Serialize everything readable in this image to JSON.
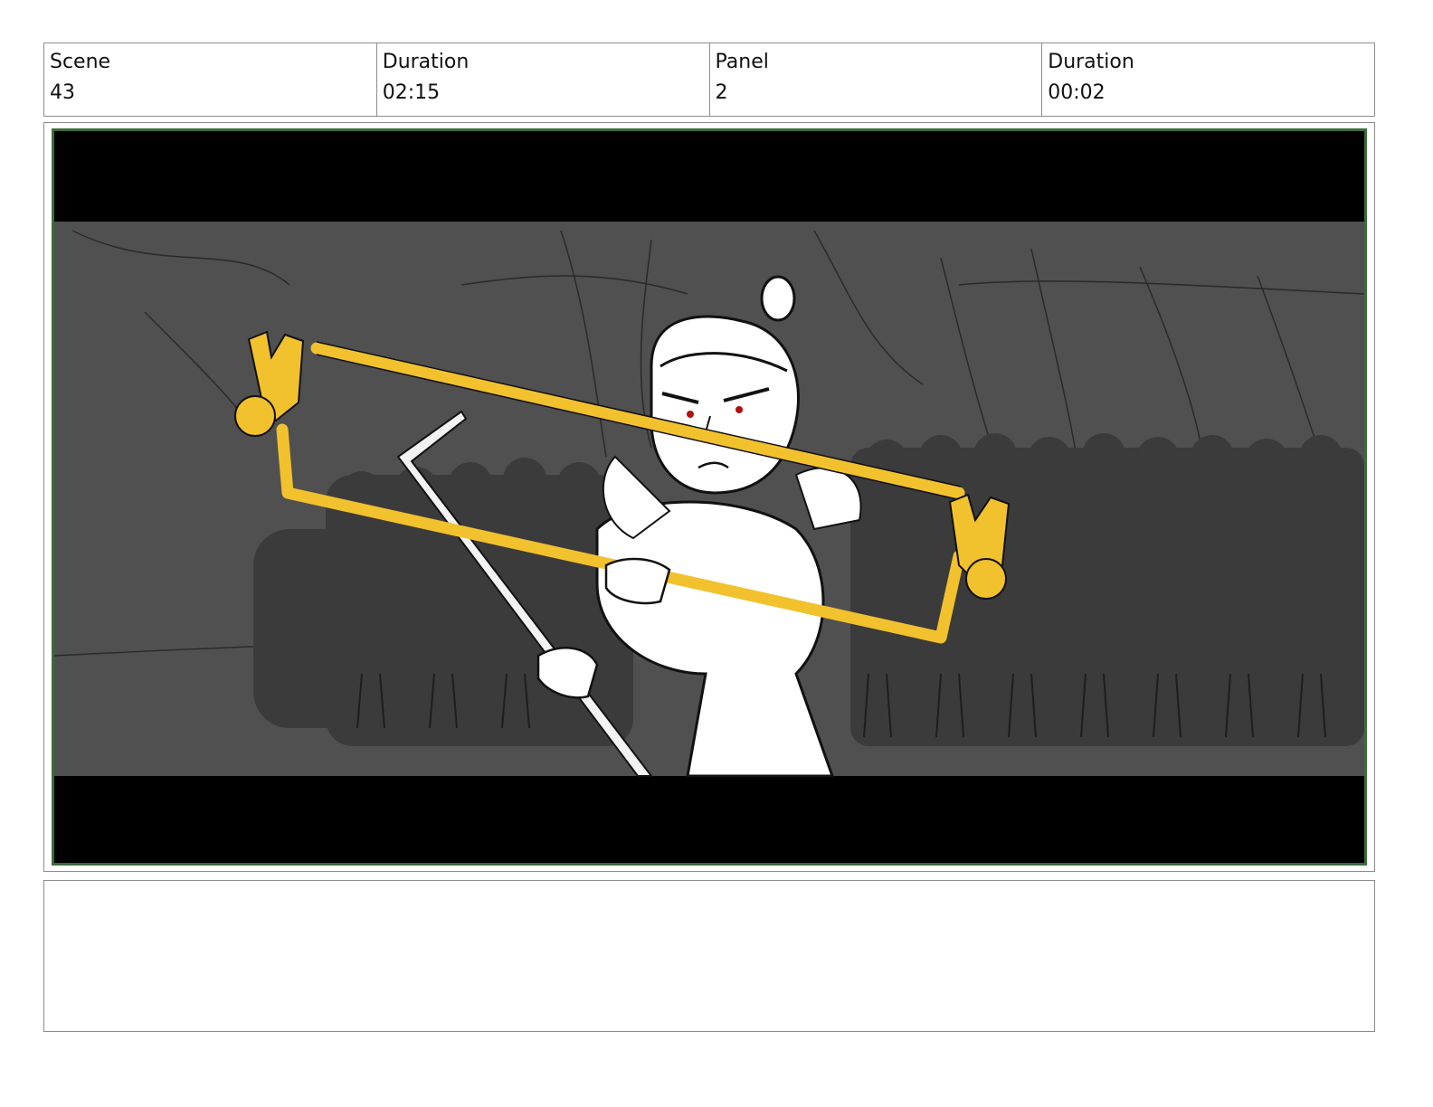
{
  "header": {
    "scene": {
      "label": "Scene",
      "value": "43"
    },
    "scene_duration": {
      "label": "Duration",
      "value": "02:15"
    },
    "panel": {
      "label": "Panel",
      "value": "2"
    },
    "panel_duration": {
      "label": "Duration",
      "value": "00:02"
    }
  },
  "panel_art": {
    "icon": "storyboard-sketch-image",
    "colors": {
      "frame_border": "#3c6b3c",
      "letterbox": "#000000",
      "background": "#505050",
      "crowd": "#3a3a3a",
      "weapon": "#f2c12e",
      "character": "#ffffff",
      "eyes": "#b01010"
    }
  },
  "notes": {
    "text": ""
  }
}
